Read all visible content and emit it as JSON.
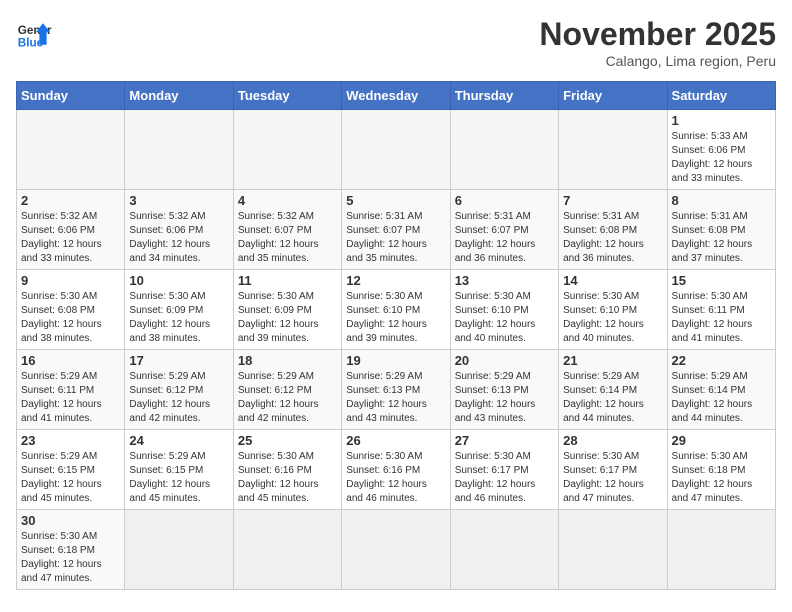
{
  "header": {
    "logo_general": "General",
    "logo_blue": "Blue",
    "title": "November 2025",
    "subtitle": "Calango, Lima region, Peru"
  },
  "days_of_week": [
    "Sunday",
    "Monday",
    "Tuesday",
    "Wednesday",
    "Thursday",
    "Friday",
    "Saturday"
  ],
  "weeks": [
    {
      "days": [
        {
          "num": "",
          "info": ""
        },
        {
          "num": "",
          "info": ""
        },
        {
          "num": "",
          "info": ""
        },
        {
          "num": "",
          "info": ""
        },
        {
          "num": "",
          "info": ""
        },
        {
          "num": "",
          "info": ""
        },
        {
          "num": "1",
          "info": "Sunrise: 5:33 AM\nSunset: 6:06 PM\nDaylight: 12 hours and 33 minutes."
        }
      ]
    },
    {
      "days": [
        {
          "num": "2",
          "info": "Sunrise: 5:32 AM\nSunset: 6:06 PM\nDaylight: 12 hours and 33 minutes."
        },
        {
          "num": "3",
          "info": "Sunrise: 5:32 AM\nSunset: 6:06 PM\nDaylight: 12 hours and 34 minutes."
        },
        {
          "num": "4",
          "info": "Sunrise: 5:32 AM\nSunset: 6:07 PM\nDaylight: 12 hours and 35 minutes."
        },
        {
          "num": "5",
          "info": "Sunrise: 5:31 AM\nSunset: 6:07 PM\nDaylight: 12 hours and 35 minutes."
        },
        {
          "num": "6",
          "info": "Sunrise: 5:31 AM\nSunset: 6:07 PM\nDaylight: 12 hours and 36 minutes."
        },
        {
          "num": "7",
          "info": "Sunrise: 5:31 AM\nSunset: 6:08 PM\nDaylight: 12 hours and 36 minutes."
        },
        {
          "num": "8",
          "info": "Sunrise: 5:31 AM\nSunset: 6:08 PM\nDaylight: 12 hours and 37 minutes."
        }
      ]
    },
    {
      "days": [
        {
          "num": "9",
          "info": "Sunrise: 5:30 AM\nSunset: 6:08 PM\nDaylight: 12 hours and 38 minutes."
        },
        {
          "num": "10",
          "info": "Sunrise: 5:30 AM\nSunset: 6:09 PM\nDaylight: 12 hours and 38 minutes."
        },
        {
          "num": "11",
          "info": "Sunrise: 5:30 AM\nSunset: 6:09 PM\nDaylight: 12 hours and 39 minutes."
        },
        {
          "num": "12",
          "info": "Sunrise: 5:30 AM\nSunset: 6:10 PM\nDaylight: 12 hours and 39 minutes."
        },
        {
          "num": "13",
          "info": "Sunrise: 5:30 AM\nSunset: 6:10 PM\nDaylight: 12 hours and 40 minutes."
        },
        {
          "num": "14",
          "info": "Sunrise: 5:30 AM\nSunset: 6:10 PM\nDaylight: 12 hours and 40 minutes."
        },
        {
          "num": "15",
          "info": "Sunrise: 5:30 AM\nSunset: 6:11 PM\nDaylight: 12 hours and 41 minutes."
        }
      ]
    },
    {
      "days": [
        {
          "num": "16",
          "info": "Sunrise: 5:29 AM\nSunset: 6:11 PM\nDaylight: 12 hours and 41 minutes."
        },
        {
          "num": "17",
          "info": "Sunrise: 5:29 AM\nSunset: 6:12 PM\nDaylight: 12 hours and 42 minutes."
        },
        {
          "num": "18",
          "info": "Sunrise: 5:29 AM\nSunset: 6:12 PM\nDaylight: 12 hours and 42 minutes."
        },
        {
          "num": "19",
          "info": "Sunrise: 5:29 AM\nSunset: 6:13 PM\nDaylight: 12 hours and 43 minutes."
        },
        {
          "num": "20",
          "info": "Sunrise: 5:29 AM\nSunset: 6:13 PM\nDaylight: 12 hours and 43 minutes."
        },
        {
          "num": "21",
          "info": "Sunrise: 5:29 AM\nSunset: 6:14 PM\nDaylight: 12 hours and 44 minutes."
        },
        {
          "num": "22",
          "info": "Sunrise: 5:29 AM\nSunset: 6:14 PM\nDaylight: 12 hours and 44 minutes."
        }
      ]
    },
    {
      "days": [
        {
          "num": "23",
          "info": "Sunrise: 5:29 AM\nSunset: 6:15 PM\nDaylight: 12 hours and 45 minutes."
        },
        {
          "num": "24",
          "info": "Sunrise: 5:29 AM\nSunset: 6:15 PM\nDaylight: 12 hours and 45 minutes."
        },
        {
          "num": "25",
          "info": "Sunrise: 5:30 AM\nSunset: 6:16 PM\nDaylight: 12 hours and 45 minutes."
        },
        {
          "num": "26",
          "info": "Sunrise: 5:30 AM\nSunset: 6:16 PM\nDaylight: 12 hours and 46 minutes."
        },
        {
          "num": "27",
          "info": "Sunrise: 5:30 AM\nSunset: 6:17 PM\nDaylight: 12 hours and 46 minutes."
        },
        {
          "num": "28",
          "info": "Sunrise: 5:30 AM\nSunset: 6:17 PM\nDaylight: 12 hours and 47 minutes."
        },
        {
          "num": "29",
          "info": "Sunrise: 5:30 AM\nSunset: 6:18 PM\nDaylight: 12 hours and 47 minutes."
        }
      ]
    },
    {
      "days": [
        {
          "num": "30",
          "info": "Sunrise: 5:30 AM\nSunset: 6:18 PM\nDaylight: 12 hours and 47 minutes."
        },
        {
          "num": "",
          "info": ""
        },
        {
          "num": "",
          "info": ""
        },
        {
          "num": "",
          "info": ""
        },
        {
          "num": "",
          "info": ""
        },
        {
          "num": "",
          "info": ""
        },
        {
          "num": "",
          "info": ""
        }
      ]
    }
  ]
}
